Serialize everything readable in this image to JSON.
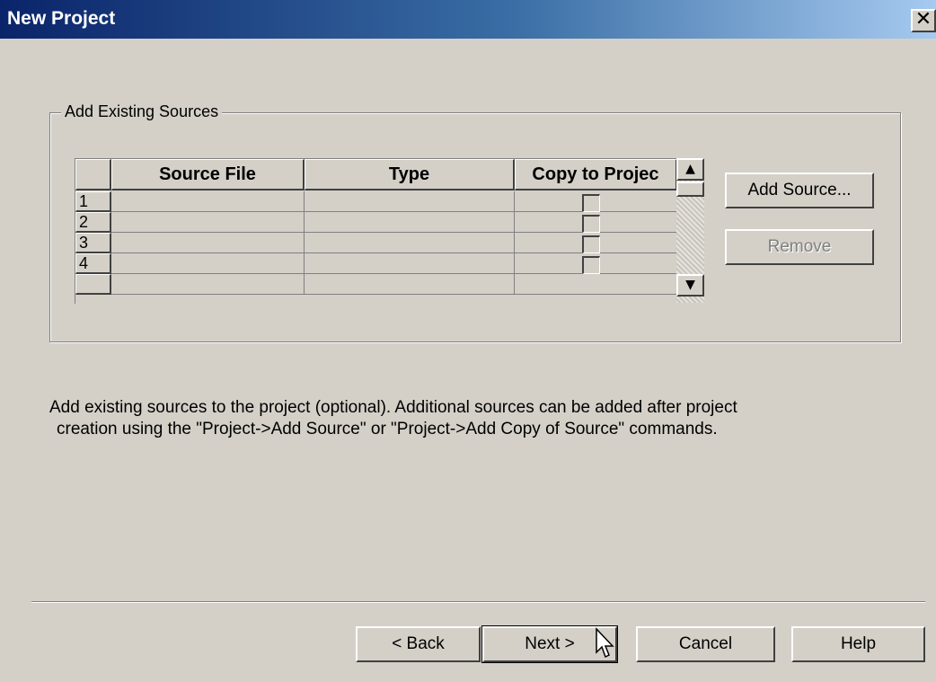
{
  "window": {
    "title": "New Project",
    "close_icon": "close-icon",
    "close_glyph": "✕"
  },
  "group": {
    "label": "Add Existing Sources"
  },
  "grid": {
    "columns": [
      "Source File",
      "Type",
      "Copy to Projec"
    ],
    "rows": [
      {
        "num": "1",
        "source_file": "",
        "type": "",
        "copy": false
      },
      {
        "num": "2",
        "source_file": "",
        "type": "",
        "copy": false
      },
      {
        "num": "3",
        "source_file": "",
        "type": "",
        "copy": false
      },
      {
        "num": "4",
        "source_file": "",
        "type": "",
        "copy": false
      }
    ]
  },
  "scrollbar": {
    "up_icon": "scroll-up-arrow-icon",
    "down_icon": "scroll-down-arrow-icon",
    "up_glyph": "▲",
    "down_glyph": "▼"
  },
  "side_buttons": {
    "add_source": "Add Source...",
    "remove": "Remove",
    "remove_enabled": false
  },
  "description": {
    "line1": "Add existing sources to the project (optional). Additional sources can be added after project",
    "line2": "creation using the \"Project->Add Source\" or \"Project->Add Copy of Source\" commands."
  },
  "footer": {
    "back": "< Back",
    "next": "Next >",
    "cancel": "Cancel",
    "help": "Help"
  },
  "colors": {
    "titlebar_start": "#0a246a",
    "titlebar_end": "#a6caf0",
    "dialog_bg": "#d4d0c8",
    "disabled_text": "#808080"
  }
}
